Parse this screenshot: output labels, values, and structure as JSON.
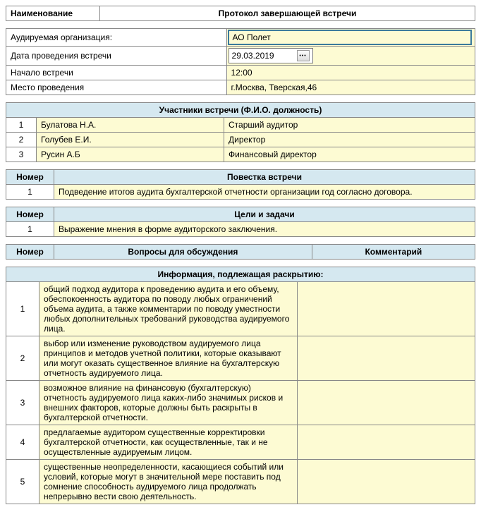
{
  "header": {
    "name_label": "Наименование",
    "title": "Протокол завершающей встречи"
  },
  "info": {
    "org_label": "Аудируемая организация:",
    "org_value": "АО Полет",
    "date_label": "Дата проведения встречи",
    "date_value": "29.03.2019",
    "start_label": "Начало встречи",
    "start_value": "12:00",
    "place_label": "Место проведения",
    "place_value": "г.Москва, Тверская,46"
  },
  "participants": {
    "title": "Участники встречи (Ф.И.О. должность)",
    "rows": [
      {
        "n": "1",
        "name": "Булатова Н.А.",
        "role": "Старший аудитор"
      },
      {
        "n": "2",
        "name": "Голубев Е.И.",
        "role": "Директор"
      },
      {
        "n": "3",
        "name": "Русин А.Б",
        "role": "Финансовый директор"
      }
    ]
  },
  "agenda": {
    "num_label": "Номер",
    "title": "Повестка встречи",
    "rows": [
      {
        "n": "1",
        "text": "Подведение итогов аудита бухгалтерской отчетности организации год согласно договора."
      }
    ]
  },
  "goals": {
    "num_label": "Номер",
    "title": "Цели и задачи",
    "rows": [
      {
        "n": "1",
        "text": "Выражение мнения в форме аудиторского заключения."
      }
    ]
  },
  "discussion": {
    "num_label": "Номер",
    "q_label": "Вопросы для обсуждения",
    "c_label": "Комментарий",
    "info_title": "Информация, подлежащая раскрытию:",
    "rows": [
      {
        "n": "1",
        "text": "общий подход аудитора к проведению аудита и его объему, обеспокоенность аудитора по поводу любых ограничений объема аудита, а также комментарии по поводу уместности любых дополнительных требований руководства аудируемого лица.",
        "comment": ""
      },
      {
        "n": "2",
        "text": "выбор или изменение руководством аудируемого лица принципов и методов учетной политики, которые оказывают или могут оказать существенное влияние на бухгалтерскую отчетность аудируемого лица.",
        "comment": ""
      },
      {
        "n": "3",
        "text": "возможное влияние на финансовую (бухгалтерскую) отчетность аудируемого лица каких-либо значимых рисков и внешних факторов, которые должны быть раскрыты в бухгалтерской отчетности.",
        "comment": ""
      },
      {
        "n": "4",
        "text": "предлагаемые аудитором существенные корректировки бухгалтерской отчетности, как осуществленные, так и не осуществленные аудируемым лицом.",
        "comment": ""
      },
      {
        "n": "5",
        "text": "существенные неопределенности, касающиеся событий или условий, которые могут в значительной мере поставить под сомнение способность аудируемого лица продолжать непрерывно вести свою деятельность.",
        "comment": ""
      }
    ]
  }
}
